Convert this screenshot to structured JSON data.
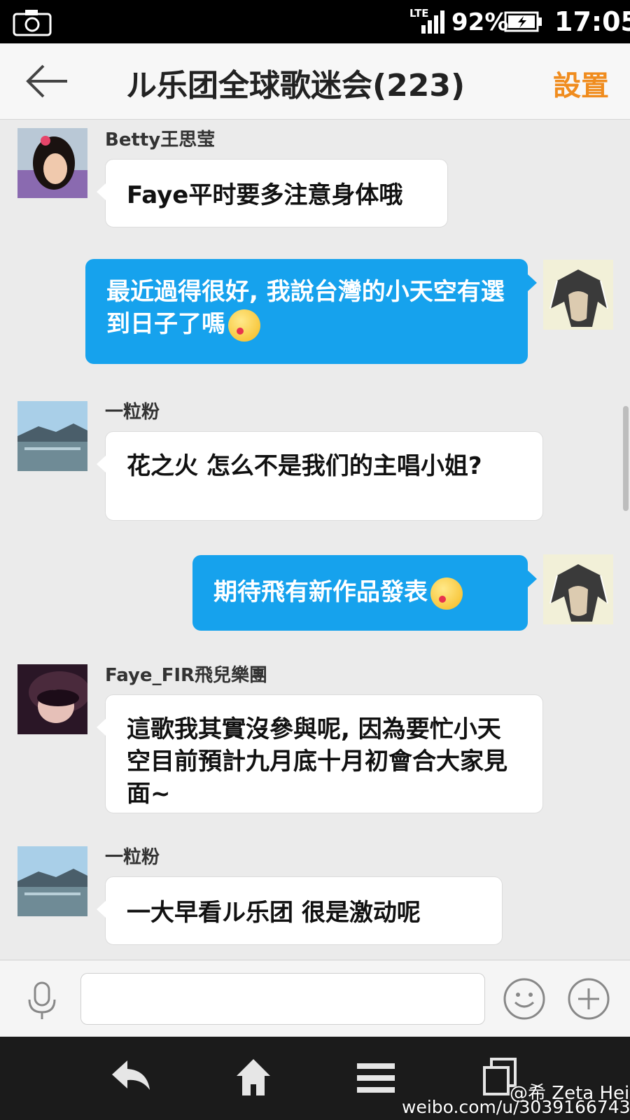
{
  "status": {
    "network": "LTE",
    "battery": "92%",
    "time": "17:05"
  },
  "header": {
    "title": "ル乐团全球歌迷会(223)",
    "settings_label": "設置"
  },
  "messages": [
    {
      "sender": "Betty王思莹",
      "text": "Faye平时要多注意身体哦",
      "direction": "in"
    },
    {
      "sender": "",
      "text": "最近過得很好, 我說台灣的小天空有選到日子了嗎",
      "direction": "out"
    },
    {
      "sender": "一粒粉",
      "text": "花之火 怎么不是我们的主唱小姐?",
      "direction": "in"
    },
    {
      "sender": "",
      "text": "期待飛有新作品發表",
      "direction": "out"
    },
    {
      "sender": "Faye_FIR飛兒樂團",
      "text": "這歌我其實沒參與呢, 因為要忙小天空目前預計九月底十月初會合大家見面~",
      "direction": "in"
    },
    {
      "sender": "一粒粉",
      "text": "一大早看ル乐团 很是激动呢",
      "direction": "in"
    }
  ],
  "input": {
    "value": "",
    "placeholder": ""
  },
  "watermark": {
    "line1": "@希 Zeta Hei",
    "line2": "weibo.com/u/3039166743"
  },
  "colors": {
    "accent": "#f08c1e",
    "outgoing_bubble": "#16a2ed",
    "background": "#ebebeb"
  }
}
